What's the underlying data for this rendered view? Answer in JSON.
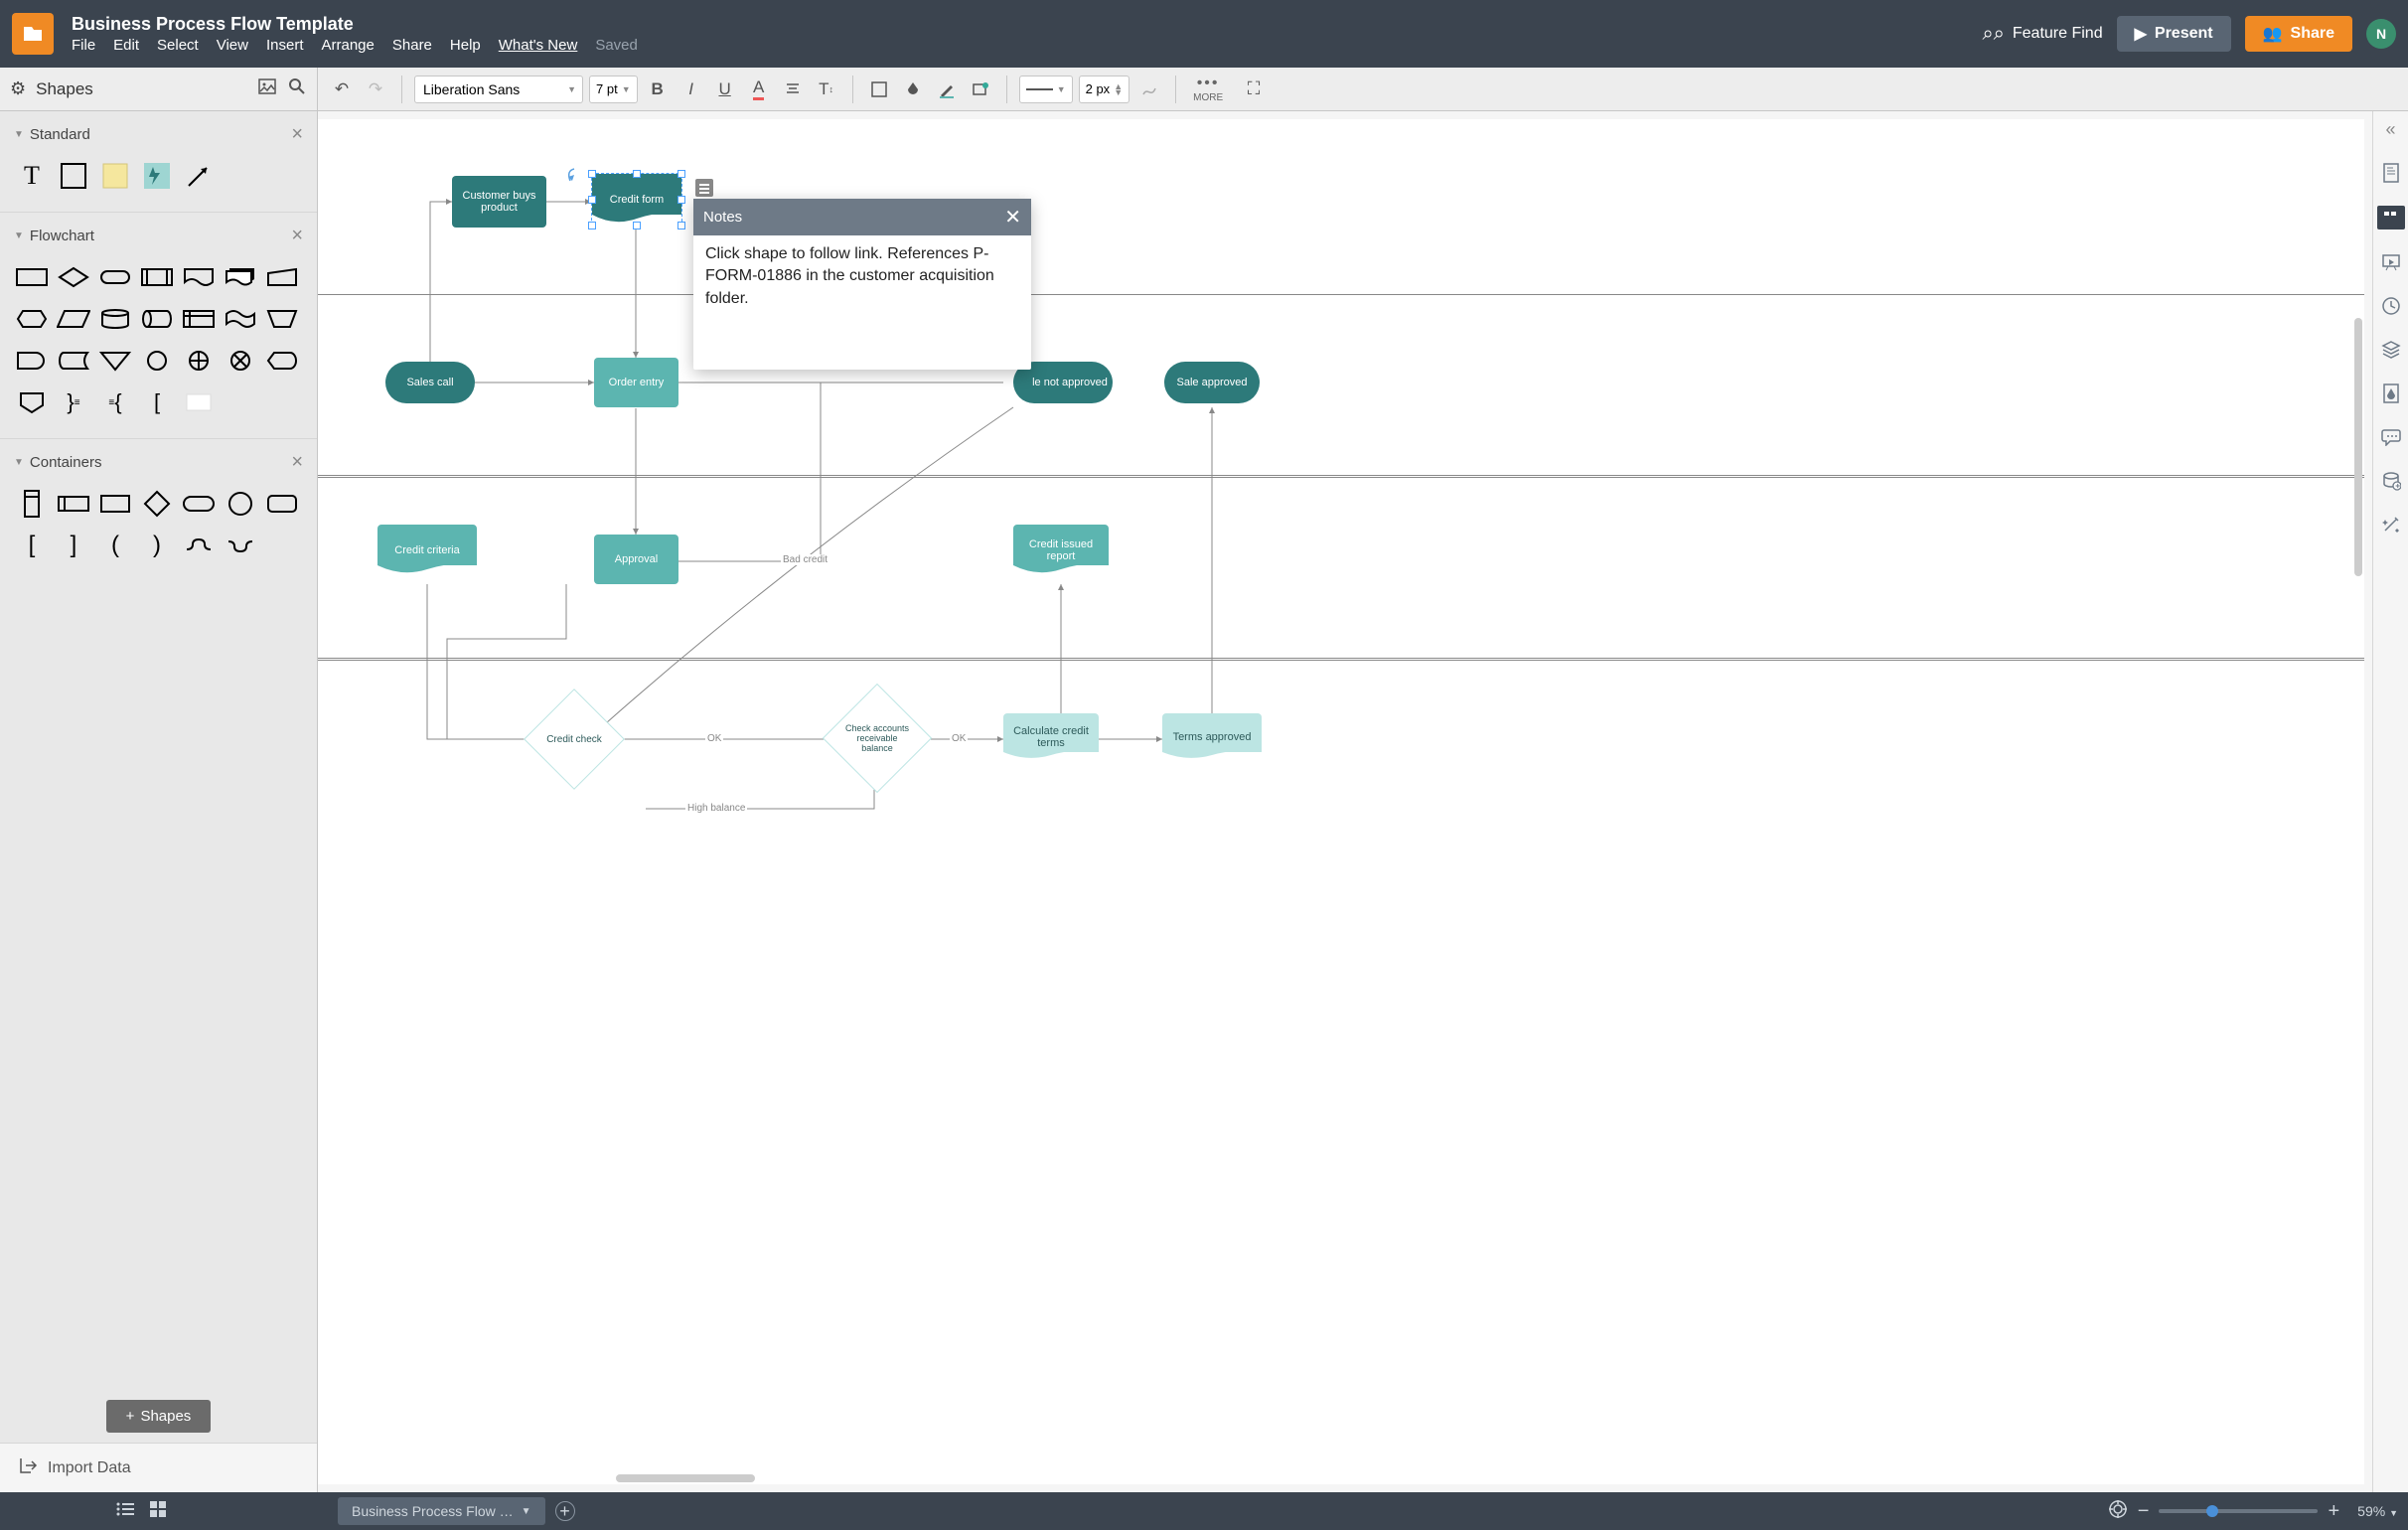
{
  "header": {
    "doc_title": "Business Process Flow Template",
    "menus": [
      "File",
      "Edit",
      "Select",
      "View",
      "Insert",
      "Arrange",
      "Share",
      "Help",
      "What's New"
    ],
    "saved": "Saved",
    "feature_find": "Feature Find",
    "present": "Present",
    "share": "Share",
    "avatar": "N"
  },
  "toolbar": {
    "shapes_label": "Shapes",
    "font": "Liberation Sans",
    "font_size": "7 pt",
    "line_width": "2 px",
    "more": "MORE"
  },
  "sidebar": {
    "groups": {
      "standard": "Standard",
      "flowchart": "Flowchart",
      "containers": "Containers"
    },
    "shapes_button": "Shapes",
    "import": "Import Data"
  },
  "canvas": {
    "shapes": {
      "sales_call": "Sales call",
      "customer_buys": "Customer buys product",
      "credit_form": "Credit form",
      "order_entry": "Order entry",
      "sale_not_approved": "le not approved",
      "sale_approved": "Sale approved",
      "credit_criteria": "Credit criteria",
      "approval": "Approval",
      "credit_issued": "Credit issued report",
      "credit_check": "Credit check",
      "check_balance": "Check accounts receivable balance",
      "calc_terms": "Calculate credit terms",
      "terms_approved": "Terms approved"
    },
    "labels": {
      "bad_credit": "Bad credit",
      "ok1": "OK",
      "ok2": "OK",
      "high_balance": "High balance"
    }
  },
  "notes": {
    "title": "Notes",
    "body": "Click shape to follow link. References P-FORM-01886 in the customer acquisition folder."
  },
  "footer": {
    "tab": "Business Process Flow …",
    "zoom": "59%"
  }
}
